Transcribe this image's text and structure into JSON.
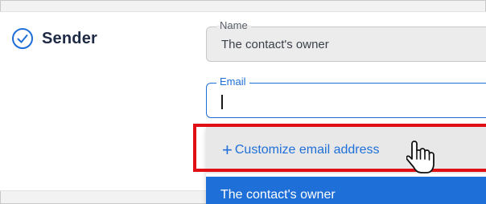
{
  "sender": {
    "title": "Sender"
  },
  "name_field": {
    "label": "Name",
    "value": "The contact's owner"
  },
  "email_field": {
    "label": "Email",
    "value": ""
  },
  "dropdown": {
    "customize_icon": "+",
    "customize_label": "Customize email address",
    "options": [
      {
        "label": "The contact's owner",
        "selected": true
      }
    ]
  },
  "colors": {
    "accent": "#1f6fd8",
    "highlight": "#e00f16",
    "title_text": "#1f2a44"
  },
  "icons": {
    "section_status": "check-circle-icon",
    "pointer": "hand-pointer-icon"
  }
}
